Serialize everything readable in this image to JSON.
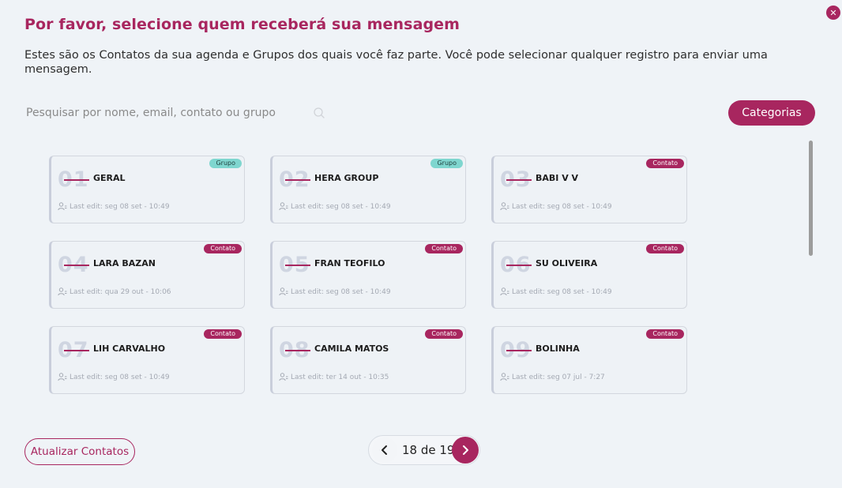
{
  "modal": {
    "title": "Por favor, selecione quem receberá sua mensagem",
    "subtitle": "Estes são os Contatos da sua agenda e Grupos dos quais você faz parte. Você pode selecionar qualquer registro para enviar uma mensagem.",
    "close_icon": "close-icon"
  },
  "search": {
    "placeholder": "Pesquisar por nome, email, contato ou grupo",
    "value": "",
    "icon": "search-icon"
  },
  "categories_button": "Categorias",
  "contacts": [
    {
      "number": "01",
      "name": "GERAL",
      "badge": "Grupo",
      "badge_type": "grupo",
      "last_edit": "Last edit: seg 08 set - 10:49"
    },
    {
      "number": "02",
      "name": "HERA GROUP",
      "badge": "Grupo",
      "badge_type": "grupo",
      "last_edit": "Last edit: seg 08 set - 10:49"
    },
    {
      "number": "03",
      "name": "BABI V V",
      "badge": "Contato",
      "badge_type": "contato",
      "last_edit": "Last edit: seg 08 set - 10:49"
    },
    {
      "number": "04",
      "name": "LARA BAZAN",
      "badge": "Contato",
      "badge_type": "contato",
      "last_edit": "Last edit: qua 29 out - 10:06"
    },
    {
      "number": "05",
      "name": "FRAN TEOFILO",
      "badge": "Contato",
      "badge_type": "contato",
      "last_edit": "Last edit: seg 08 set - 10:49"
    },
    {
      "number": "06",
      "name": "SU OLIVEIRA",
      "badge": "Contato",
      "badge_type": "contato",
      "last_edit": "Last edit: seg 08 set - 10:49"
    },
    {
      "number": "07",
      "name": "LIH CARVALHO",
      "badge": "Contato",
      "badge_type": "contato",
      "last_edit": "Last edit: seg 08 set - 10:49"
    },
    {
      "number": "08",
      "name": "CAMILA MATOS",
      "badge": "Contato",
      "badge_type": "contato",
      "last_edit": "Last edit: ter 14 out - 10:35"
    },
    {
      "number": "09",
      "name": "BOLINHA",
      "badge": "Contato",
      "badge_type": "contato",
      "last_edit": "Last edit: seg 07 jul - 7:27"
    }
  ],
  "footer": {
    "update_button": "Atualizar Contatos",
    "pagination": {
      "label": "18 de 19",
      "prev_icon": "chevron-left-icon",
      "next_icon": "chevron-right-icon"
    }
  },
  "colors": {
    "accent": "#a8265f",
    "group_badge": "#7fd6cf",
    "background": "#eff3f7"
  }
}
